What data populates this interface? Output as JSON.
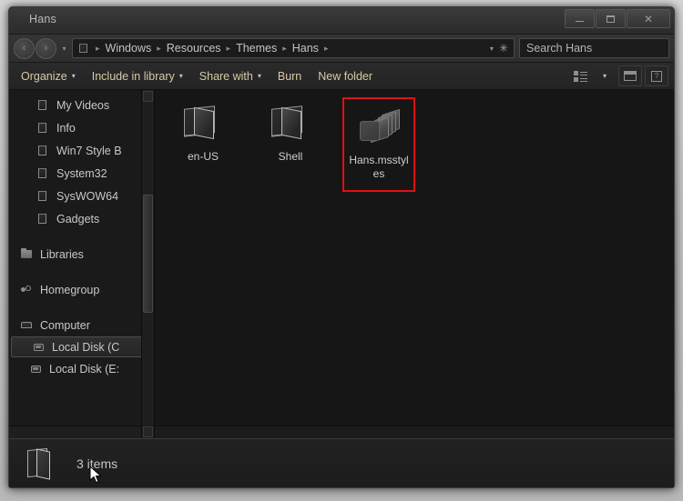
{
  "window": {
    "title": "Hans",
    "controls": {
      "minimize": "—",
      "maximize": "□",
      "close": "✕"
    }
  },
  "navbar": {
    "back_label": "‹",
    "forward_label": "›",
    "history_caret": "▾",
    "breadcrumb_leading_sep": "▸",
    "breadcrumb": [
      "Windows",
      "Resources",
      "Themes",
      "Hans"
    ],
    "breadcrumb_separator": "▸",
    "address_caret": "▾",
    "refresh_glyph": "✳",
    "folder_icon_name": "folder-icon"
  },
  "search": {
    "placeholder": "Search Hans",
    "value": "",
    "icon_name": "search-icon"
  },
  "toolbar": {
    "items": [
      {
        "label": "Organize",
        "caret": "▾"
      },
      {
        "label": "Include in library",
        "caret": "▾"
      },
      {
        "label": "Share with",
        "caret": "▾"
      },
      {
        "label": "Burn",
        "caret": ""
      },
      {
        "label": "New folder",
        "caret": ""
      }
    ],
    "view_caret": "▾",
    "view_icon_name": "view-mode-icon",
    "preview_icon_name": "preview-pane-icon",
    "help_icon_name": "help-icon",
    "help_glyph": "?"
  },
  "sidebar": {
    "items": [
      {
        "label": "My Videos",
        "icon": "folder-icon",
        "indent": 2,
        "selected": false,
        "group": false
      },
      {
        "label": "Info",
        "icon": "folder-icon",
        "indent": 2,
        "selected": false,
        "group": false
      },
      {
        "label": "Win7 Style B",
        "icon": "folder-icon",
        "indent": 2,
        "selected": false,
        "group": false
      },
      {
        "label": "System32",
        "icon": "folder-icon",
        "indent": 2,
        "selected": false,
        "group": false
      },
      {
        "label": "SysWOW64",
        "icon": "folder-icon",
        "indent": 2,
        "selected": false,
        "group": false
      },
      {
        "label": "Gadgets",
        "icon": "folder-icon",
        "indent": 2,
        "selected": false,
        "group": false
      },
      {
        "label": "Libraries",
        "icon": "library-icon",
        "indent": 0,
        "selected": false,
        "group": true
      },
      {
        "label": "Homegroup",
        "icon": "homegroup-icon",
        "indent": 0,
        "selected": false,
        "group": true
      },
      {
        "label": "Computer",
        "icon": "computer-icon",
        "indent": 0,
        "selected": false,
        "group": true
      },
      {
        "label": "Local Disk (C",
        "icon": "disk-icon",
        "indent": 1,
        "selected": true,
        "group": false
      },
      {
        "label": "Local Disk (E:",
        "icon": "disk-icon",
        "indent": 1,
        "selected": false,
        "group": false
      }
    ]
  },
  "files": {
    "items": [
      {
        "name": "en-US",
        "icon": "open-folder-icon",
        "highlighted": false
      },
      {
        "name": "Shell",
        "icon": "open-folder-icon",
        "highlighted": false
      },
      {
        "name": "Hans.msstyles",
        "icon": "msstyles-file-icon",
        "highlighted": true
      }
    ],
    "highlight_color": "#e01010"
  },
  "statusbar": {
    "item_count_text": "3 items",
    "icon_name": "open-folder-icon"
  },
  "colors": {
    "window_background": "#1d1d1d",
    "toolbar_text": "#d9c9a6",
    "body_text": "#c8c8c8",
    "accent_highlight": "#e01010"
  }
}
